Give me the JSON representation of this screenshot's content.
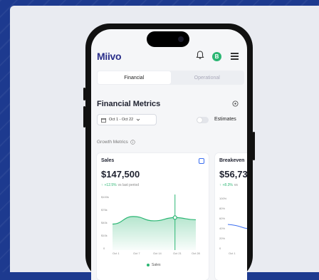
{
  "app": {
    "logo": "Miivo",
    "avatar_initial": "B"
  },
  "tabs": [
    {
      "label": "Financial",
      "active": true
    },
    {
      "label": "Operational",
      "active": false
    }
  ],
  "section": {
    "title": "Financial Metrics",
    "date_range": "Oct 1 - Oct 22",
    "estimates_label": "Estimates",
    "estimates_on": false,
    "growth_label": "Growth Metrics"
  },
  "cards": [
    {
      "title": "Sales",
      "value": "$147,500",
      "change": "+12.5%",
      "change_note": "vs last period",
      "y_ticks": [
        "$100k",
        "$75k",
        "$40k",
        "$10k",
        "0"
      ],
      "x_ticks": [
        "Oct 1",
        "Oct 7",
        "Oct 14",
        "Oct 21",
        "Oct 28"
      ],
      "legend": "Sales"
    },
    {
      "title": "Breakeven",
      "value": "$56,73",
      "change": "+8.3%",
      "change_note": "vs",
      "y_ticks": [
        "100%",
        "80%",
        "60%",
        "40%",
        "20%",
        "0"
      ],
      "x_ticks": [
        "Oct 1"
      ]
    }
  ],
  "chart_data": [
    {
      "type": "area",
      "x": [
        "Oct 1",
        "Oct 7",
        "Oct 14",
        "Oct 21",
        "Oct 28"
      ],
      "series": [
        {
          "name": "Sales",
          "values": [
            48000,
            62000,
            54000,
            60000,
            56000
          ]
        }
      ],
      "ylim": [
        0,
        100000
      ],
      "highlight_x": "Oct 21"
    }
  ],
  "colors": {
    "accent": "#2bb673",
    "brand": "#2a2f8a",
    "link": "#3b6ef0"
  }
}
